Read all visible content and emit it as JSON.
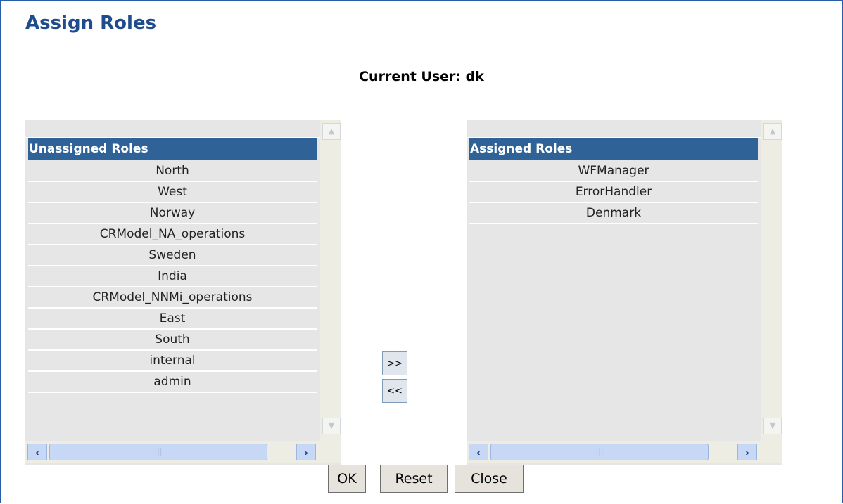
{
  "page": {
    "title": "Assign Roles",
    "current_user": "Current User: dk"
  },
  "unassigned": {
    "header": "Unassigned Roles",
    "items": [
      "North",
      "West",
      "Norway",
      "CRModel_NA_operations",
      "Sweden",
      "India",
      "CRModel_NNMi_operations",
      "East",
      "South",
      "internal",
      "admin"
    ]
  },
  "assigned": {
    "header": "Assigned Roles",
    "items": [
      "WFManager",
      "ErrorHandler",
      "Denmark"
    ]
  },
  "controls": {
    "add_label": ">>",
    "remove_label": "<<"
  },
  "buttons": {
    "ok": "OK",
    "reset": "Reset",
    "close": "Close"
  },
  "colors": {
    "header_bg": "#2f6297",
    "title": "#1f4c8c",
    "frame": "#2a5fa8"
  }
}
